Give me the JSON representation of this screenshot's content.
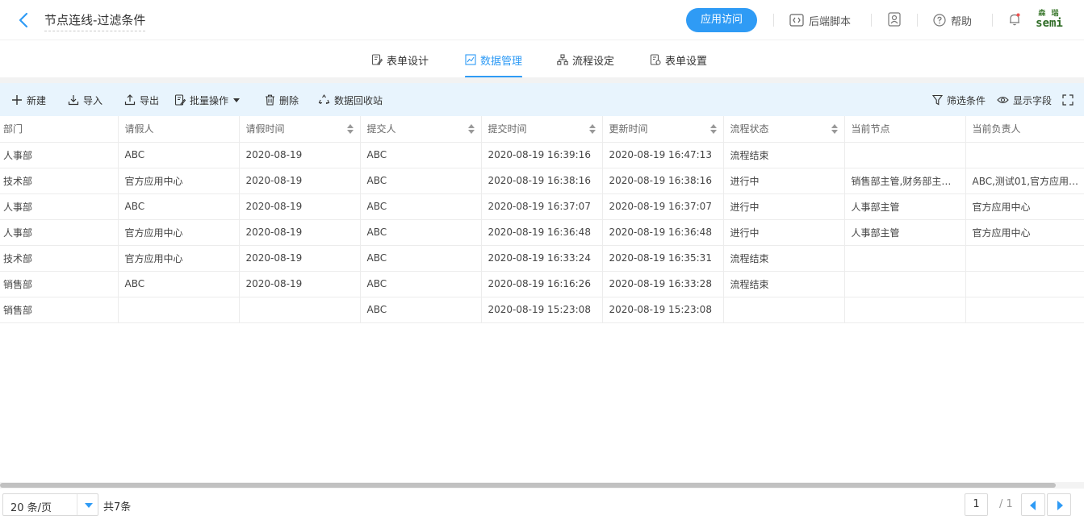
{
  "header": {
    "title": "节点连线-过滤条件",
    "visit_label": "应用访问",
    "script_label": "后端脚本",
    "help_label": "帮助",
    "logo_line1": "森 瑞",
    "logo_line2": "semi"
  },
  "tabs": [
    {
      "label": "表单设计",
      "icon": "form-edit-icon"
    },
    {
      "label": "数据管理",
      "icon": "chart-icon",
      "active": true
    },
    {
      "label": "流程设定",
      "icon": "flow-icon"
    },
    {
      "label": "表单设置",
      "icon": "settings-doc-icon"
    }
  ],
  "toolbar": {
    "new_label": "新建",
    "import_label": "导入",
    "export_label": "导出",
    "batch_label": "批量操作",
    "delete_label": "删除",
    "recycle_label": "数据回收站",
    "filter_label": "筛选条件",
    "fields_label": "显示字段"
  },
  "table": {
    "columns": [
      "部门",
      "请假人",
      "请假时间",
      "提交人",
      "提交时间",
      "更新时间",
      "流程状态",
      "当前节点",
      "当前负责人"
    ],
    "rows": [
      [
        "人事部",
        "ABC",
        "2020-08-19",
        "ABC",
        "2020-08-19 16:39:16",
        "2020-08-19 16:47:13",
        "流程结束",
        "",
        ""
      ],
      [
        "技术部",
        "官方应用中心",
        "2020-08-19",
        "ABC",
        "2020-08-19 16:38:16",
        "2020-08-19 16:38:16",
        "进行中",
        "销售部主管,财务部主管...",
        "ABC,测试01,官方应用中..."
      ],
      [
        "人事部",
        "ABC",
        "2020-08-19",
        "ABC",
        "2020-08-19 16:37:07",
        "2020-08-19 16:37:07",
        "进行中",
        "人事部主管",
        "官方应用中心"
      ],
      [
        "人事部",
        "官方应用中心",
        "2020-08-19",
        "ABC",
        "2020-08-19 16:36:48",
        "2020-08-19 16:36:48",
        "进行中",
        "人事部主管",
        "官方应用中心"
      ],
      [
        "技术部",
        "官方应用中心",
        "2020-08-19",
        "ABC",
        "2020-08-19 16:33:24",
        "2020-08-19 16:35:31",
        "流程结束",
        "",
        ""
      ],
      [
        "销售部",
        "ABC",
        "2020-08-19",
        "ABC",
        "2020-08-19 16:16:26",
        "2020-08-19 16:33:28",
        "流程结束",
        "",
        ""
      ],
      [
        "销售部",
        "",
        "",
        "ABC",
        "2020-08-19 15:23:08",
        "2020-08-19 15:23:08",
        "",
        "",
        ""
      ]
    ]
  },
  "footer": {
    "page_size": "20 条/页",
    "total": "共7条",
    "current_page": "1",
    "page_total": "/ 1"
  },
  "colors": {
    "accent": "#2f9bf5",
    "toolbar_bg": "#e8f4fd"
  }
}
